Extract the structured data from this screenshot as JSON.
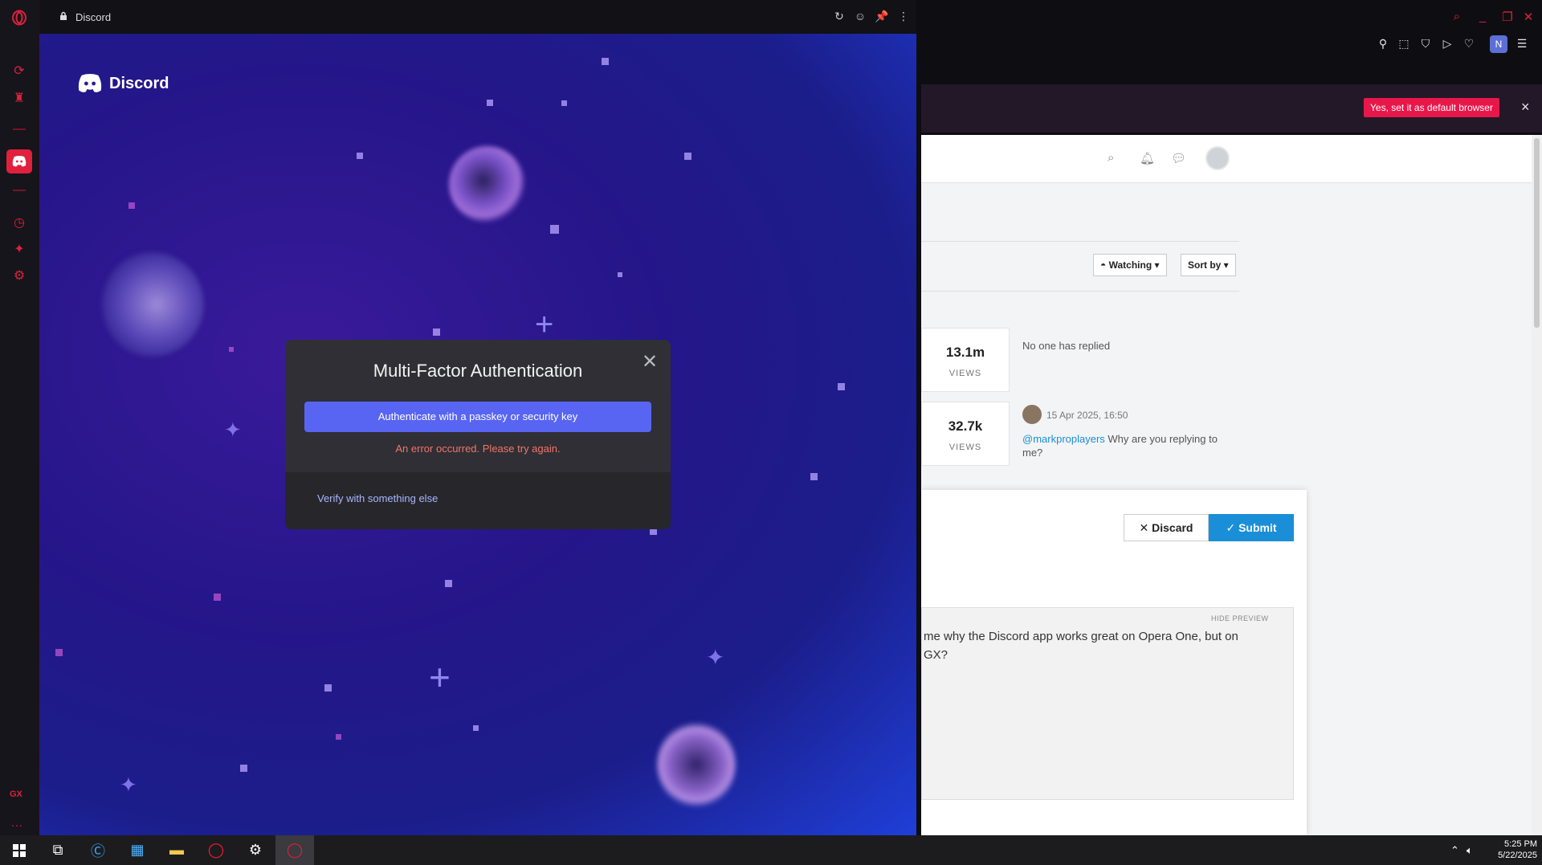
{
  "discord_window": {
    "title": "Discord",
    "brand": "Discord",
    "modal": {
      "title": "Multi-Factor Authentication",
      "primary_button": "Authenticate with a passkey or security key",
      "error": "An error occurred. Please try again.",
      "alt_link": "Verify with something else"
    }
  },
  "sidebar": {
    "gx_label": "GX",
    "more_label": "..."
  },
  "browser": {
    "profile_initial": "N",
    "notification": {
      "button": "Yes, set it as default browser",
      "close": "×"
    }
  },
  "forum": {
    "dropdowns": {
      "watching": "Watching",
      "sort_by": "Sort by"
    },
    "stats": [
      {
        "value": "13.1m",
        "label": "VIEWS"
      },
      {
        "value": "32.7k",
        "label": "VIEWS"
      }
    ],
    "no_reply": "No one has replied",
    "post": {
      "date": "15 Apr 2025, 16:50",
      "mention": "@markproplayers",
      "text": " Why are you replying to me?"
    },
    "editor": {
      "discard": "Discard",
      "submit": "Submit",
      "hide_preview": "HIDE PREVIEW",
      "preview_text": "me why the Discord app works great on Opera One, but on GX?"
    }
  },
  "taskbar": {
    "time": "5:25 PM",
    "date": "5/22/2025"
  },
  "colors": {
    "opera_red": "#e0203c",
    "discord_blurple": "#5865f2",
    "forum_blue": "#1a8fd8"
  }
}
